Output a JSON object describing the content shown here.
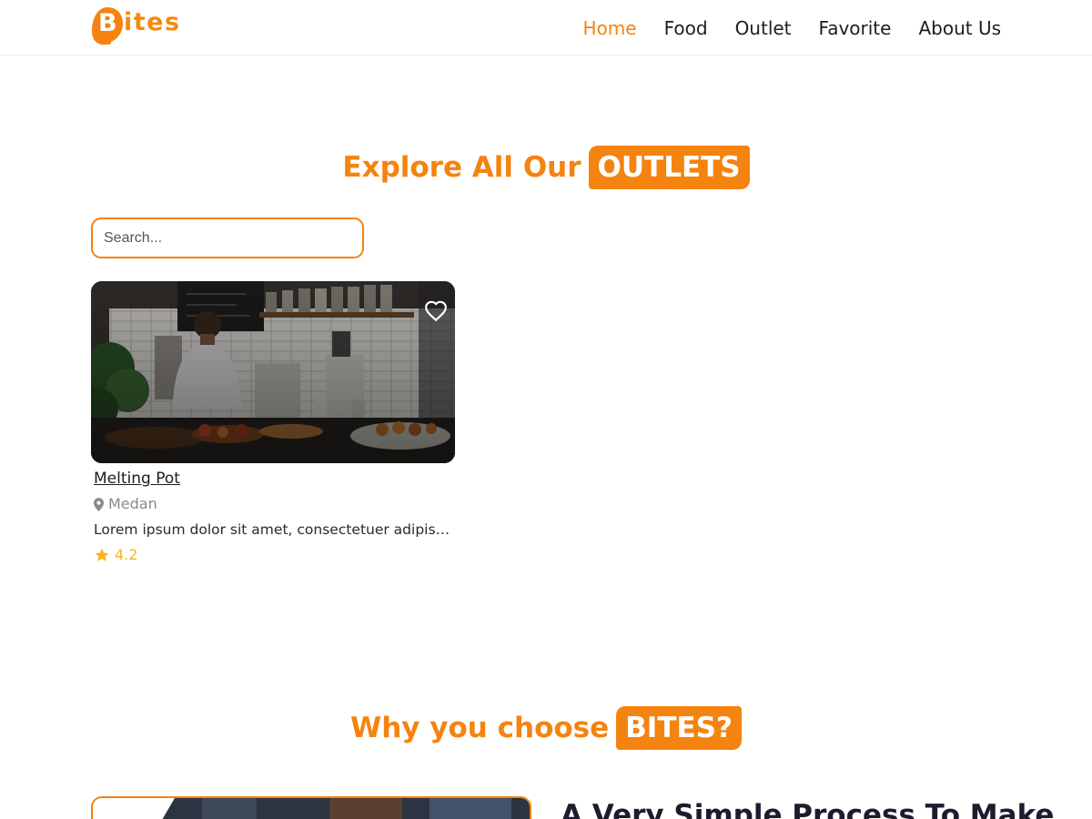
{
  "brand": {
    "logo_first_letter": "B",
    "logo_rest": "ites",
    "accent_color": "#f5830f"
  },
  "nav": {
    "items": [
      {
        "label": "Home",
        "active": true
      },
      {
        "label": "Food",
        "active": false
      },
      {
        "label": "Outlet",
        "active": false
      },
      {
        "label": "Favorite",
        "active": false
      },
      {
        "label": "About Us",
        "active": false
      }
    ]
  },
  "outlets_section": {
    "title_plain": "Explore All Our",
    "title_highlight": "OUTLETS",
    "search_placeholder": "Search...",
    "cards": [
      {
        "name": "Melting Pot",
        "location": "Medan",
        "description": "Lorem ipsum dolor sit amet, consectetuer adipiscing elit.",
        "rating": "4.2",
        "favorite_icon": "heart-icon",
        "location_icon": "map-pin-icon",
        "rating_icon": "star-icon"
      }
    ]
  },
  "why_section": {
    "title_plain": "Why you choose",
    "title_highlight": "BITES?",
    "heading": "A Very Simple Process To Make"
  }
}
